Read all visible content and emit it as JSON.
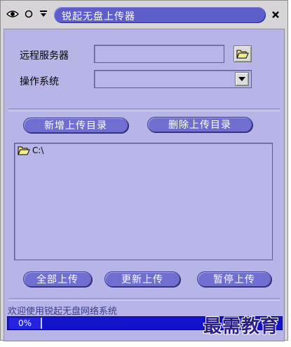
{
  "window": {
    "title": "锐起无盘上传器"
  },
  "form": {
    "remote_server_label": "远程服务器",
    "remote_server_value": "",
    "os_label": "操作系统",
    "os_value": ""
  },
  "buttons": {
    "add_dir": "新增上传目录",
    "delete_dir": "删除上传目录",
    "upload_all": "全部上传",
    "update_upload": "更新上传",
    "pause_upload": "暂停上传"
  },
  "directories": [
    {
      "label": "C:\\"
    }
  ],
  "status": {
    "welcome": "欢迎使用锐起无盘网络系统",
    "progress_text": "0%",
    "progress_value": 0
  },
  "watermark": "最需教育",
  "colors": {
    "title_bar": "#5d5ec9",
    "client_bg": "#b7b5e8",
    "button": "#6f6fd2",
    "status_bar": "#1313cc"
  }
}
